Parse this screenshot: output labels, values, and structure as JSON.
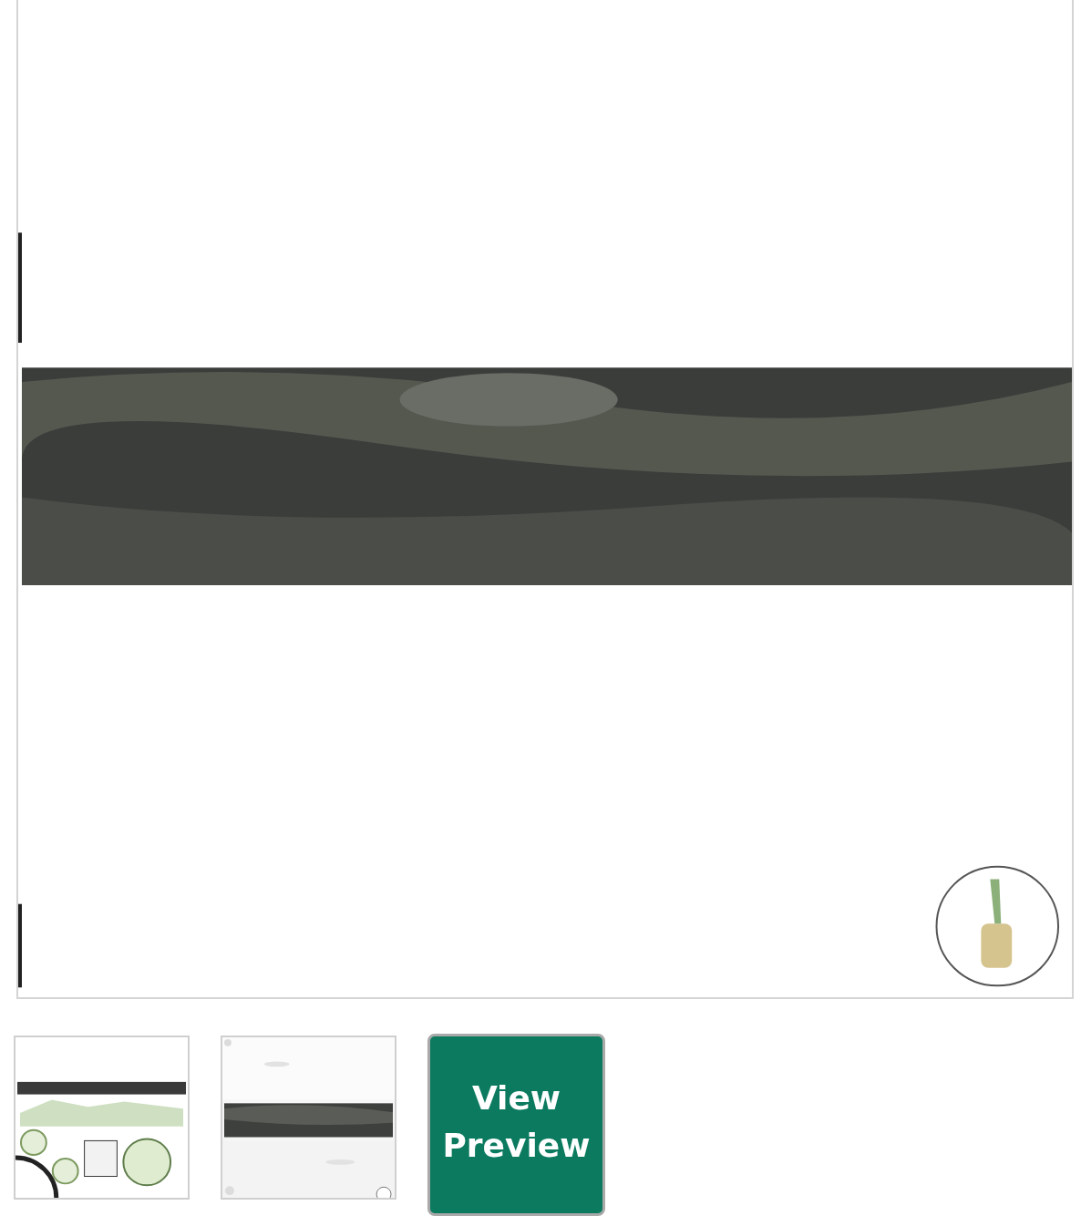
{
  "preview_button": {
    "label": "View Preview"
  }
}
